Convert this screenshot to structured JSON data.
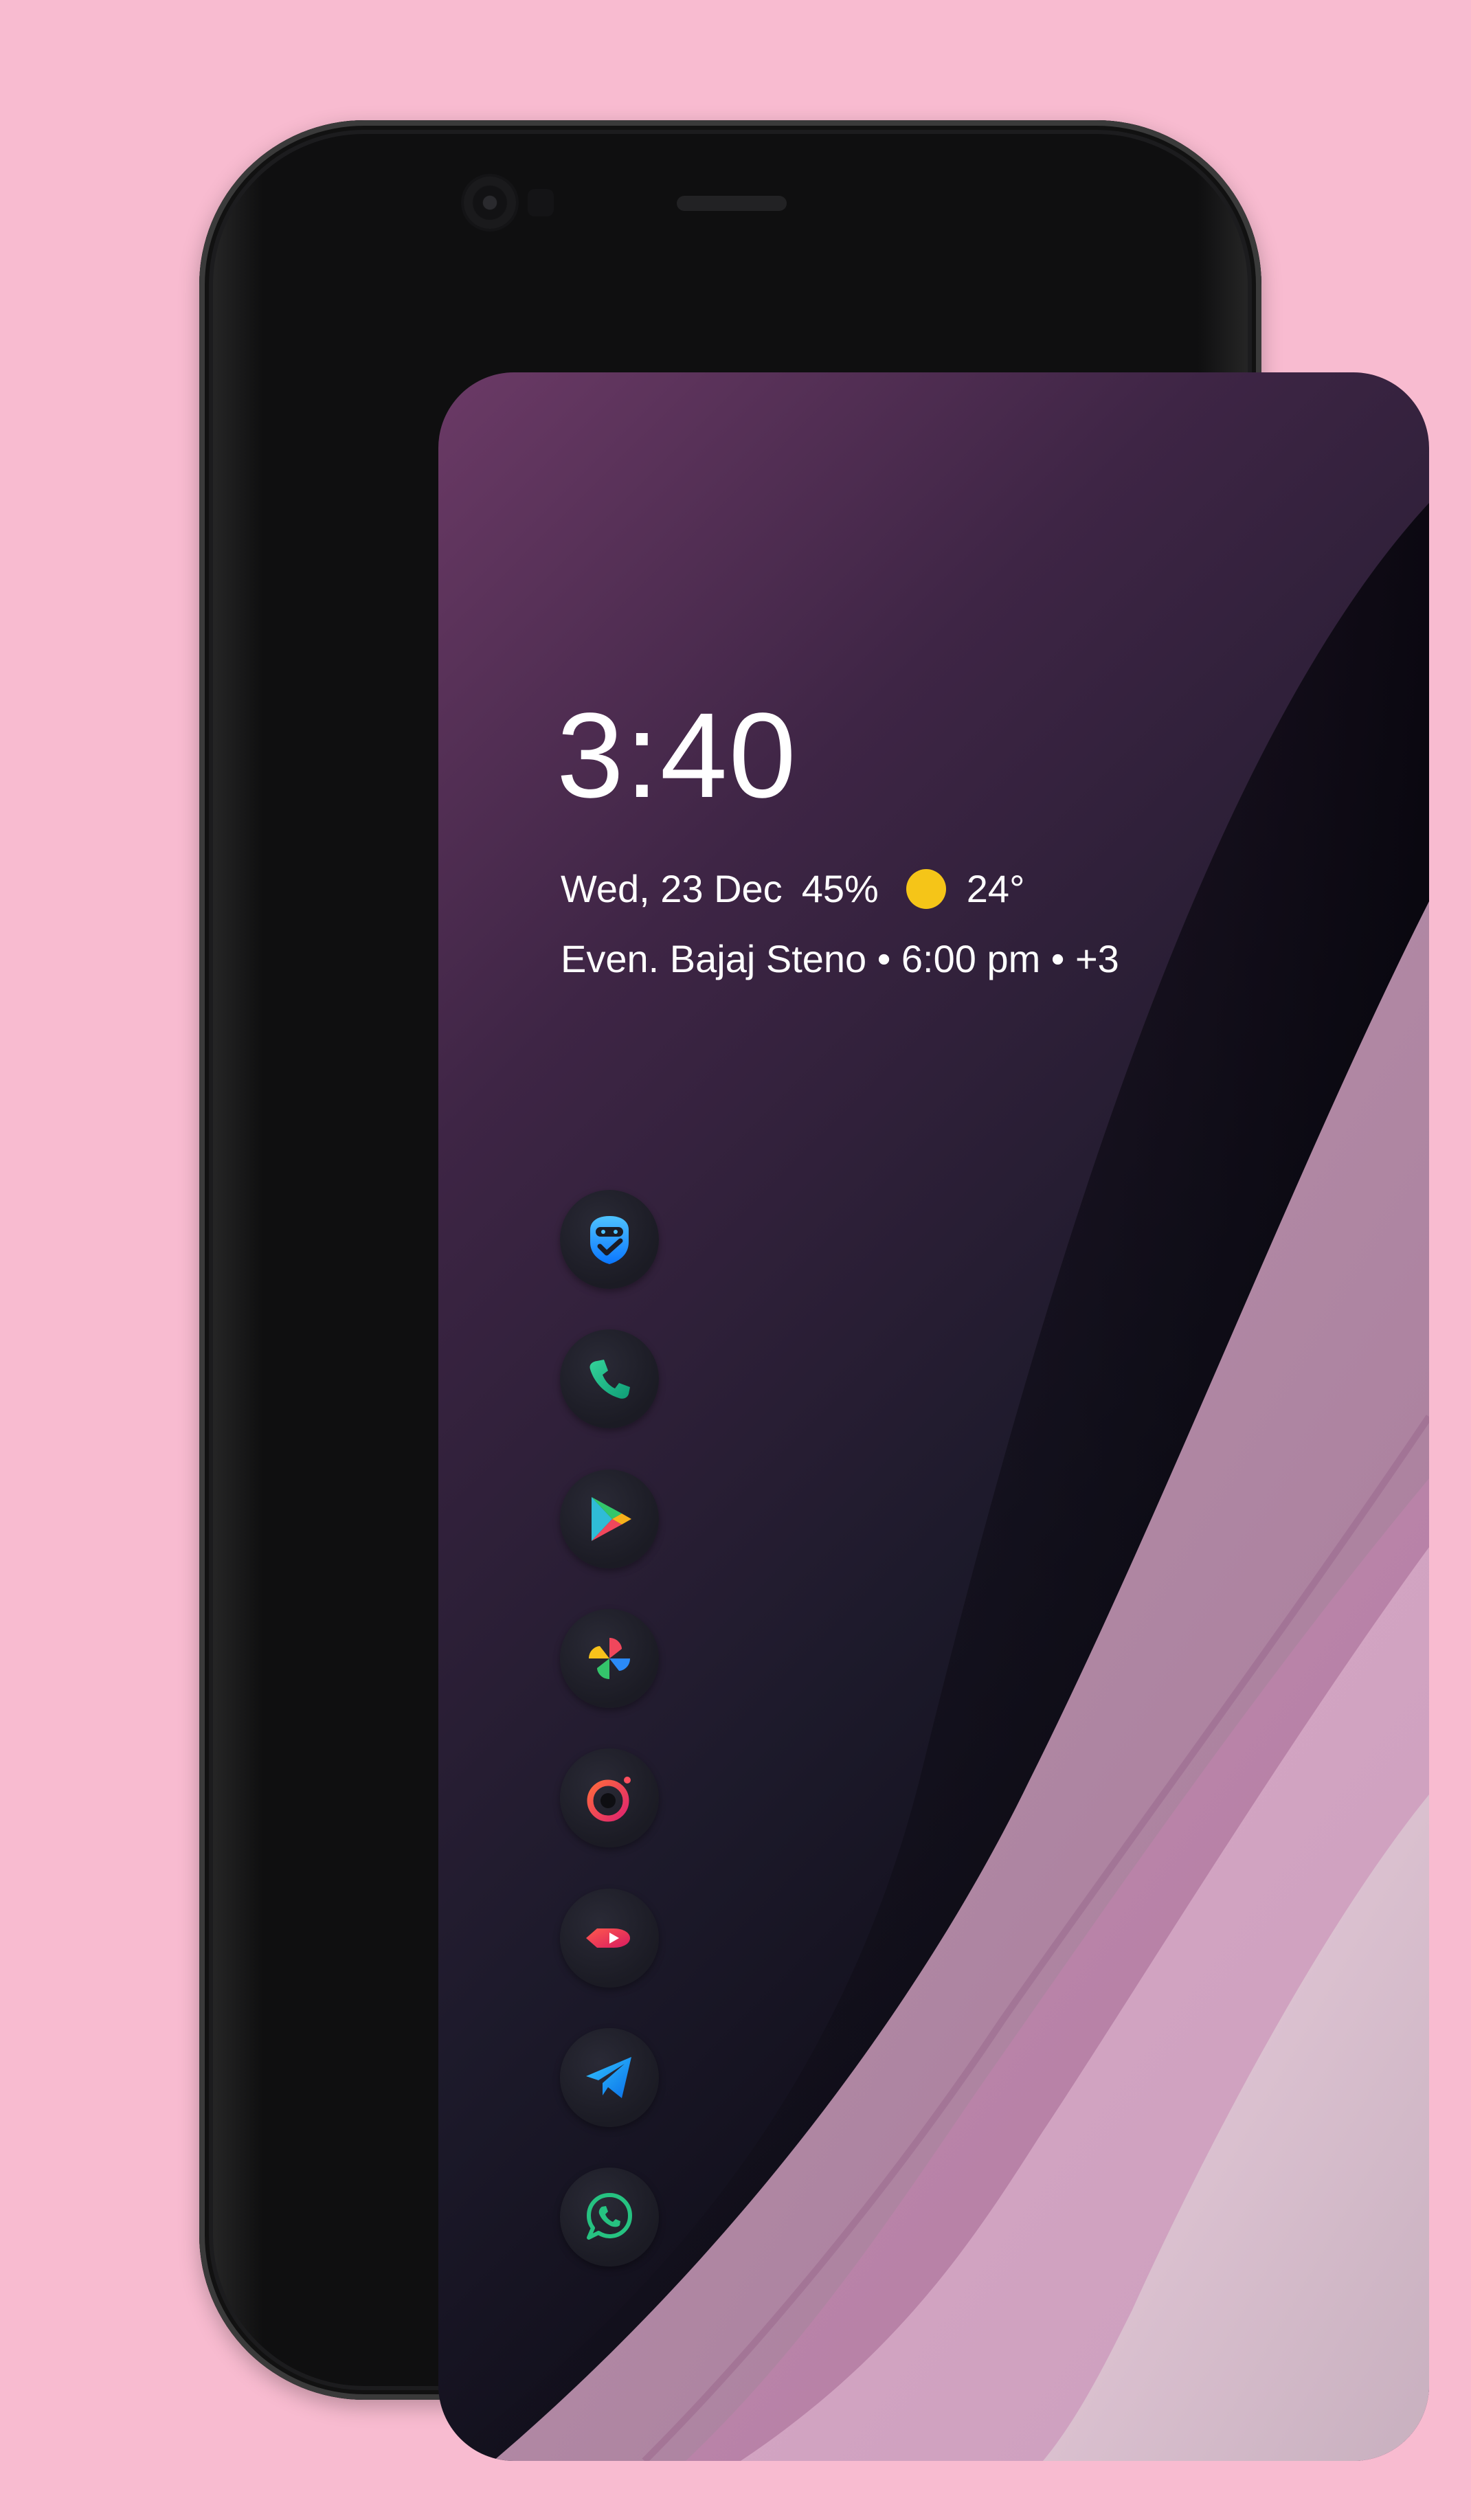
{
  "lock_screen": {
    "time": "3:40",
    "date": "Wed, 23 Dec",
    "battery": "45%",
    "weather_icon": "sun-icon",
    "temperature": "24°",
    "event": "Even. Bajaj Steno • 6:00 pm • +3"
  },
  "dock": {
    "apps": [
      {
        "name": "guardian-app-icon"
      },
      {
        "name": "phone-app-icon"
      },
      {
        "name": "play-store-app-icon"
      },
      {
        "name": "photos-app-icon"
      },
      {
        "name": "camera-app-icon"
      },
      {
        "name": "video-app-icon"
      },
      {
        "name": "telegram-app-icon"
      },
      {
        "name": "whatsapp-app-icon"
      }
    ]
  },
  "colors": {
    "background": "#f8bbd0",
    "sun": "#f5c518",
    "text": "#ffffff"
  }
}
